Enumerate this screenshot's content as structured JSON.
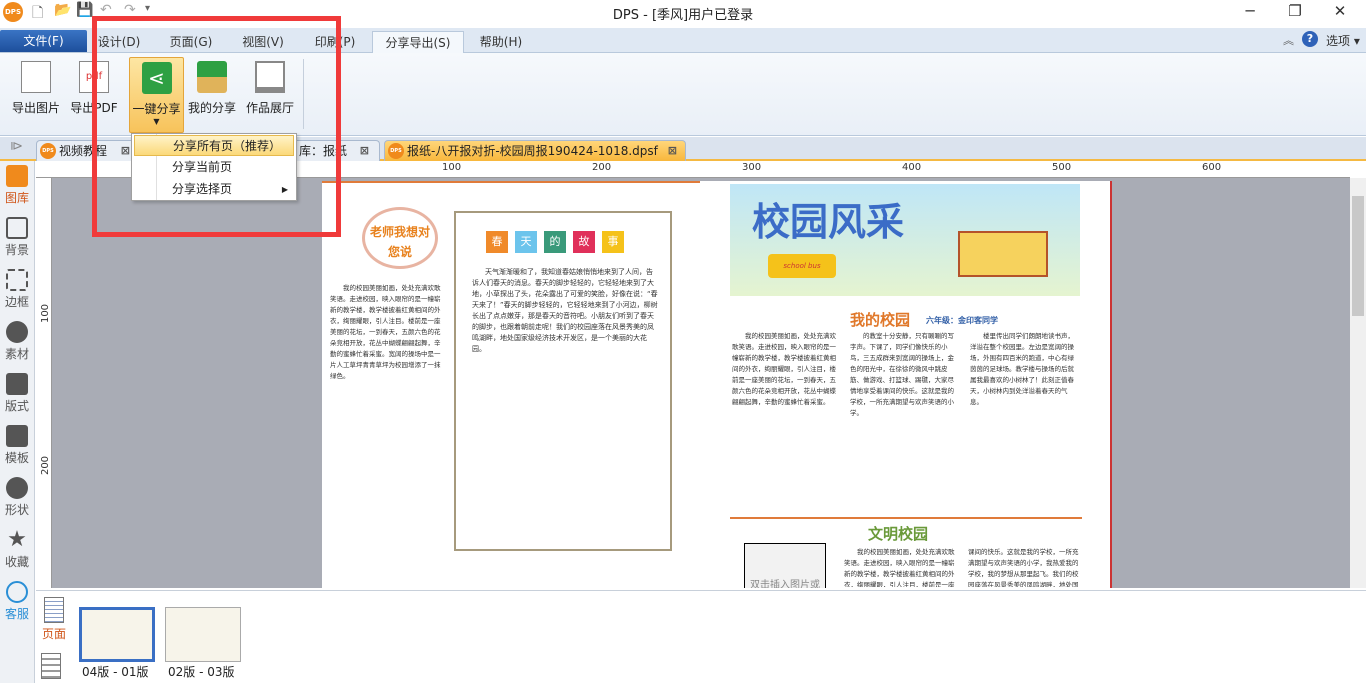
{
  "app": {
    "title": "DPS - [季风]用户已登录",
    "logo": "DPS"
  },
  "menu": {
    "tabs": [
      "文件(F)",
      "设计(D)",
      "页面(G)",
      "视图(V)",
      "印刷(P)",
      "分享导出(S)",
      "帮助(H)"
    ],
    "options": "选项"
  },
  "ribbon": {
    "buttons": [
      "导出图片",
      "导出PDF",
      "一键分享",
      "我的分享",
      "作品展厅"
    ]
  },
  "dropdown": {
    "items": [
      "分享所有页（推荐）",
      "分享当前页",
      "分享选择页"
    ]
  },
  "doc_tabs": [
    {
      "label": "视频教程"
    },
    {
      "label": "库：报纸"
    },
    {
      "label": "报纸-八开报对折-校园周报190424-1018.dpsf"
    }
  ],
  "sidebar": [
    "图库",
    "背景",
    "边框",
    "素材",
    "版式",
    "模板",
    "形状",
    "收藏",
    "客服"
  ],
  "ruler": {
    "top": [
      "100",
      "200",
      "300",
      "400",
      "500",
      "600"
    ],
    "left": [
      "100",
      "200"
    ]
  },
  "newspaper": {
    "left_title": "老师我想对您说",
    "story_title": [
      "春",
      "天",
      "的",
      "故",
      "事"
    ],
    "left_col": "我的校园美丽如画，处处充满欢歌笑语。走进校园，映入眼帘的是一幢崭新的教学楼，教学楼披着红黄相间的外衣，绚丽耀眼，引人注目。楼前是一座美丽的花坛，一到春天，五颜六色的花朵竞相开放，花丛中蝴蝶翩翩起舞，辛勤的蜜蜂忙着采蜜。宽阔的操场中是一片人工草坪青青草坪为校园增添了一抹绿色。",
    "story_text": "天气渐渐暖和了，我知道春姑娘悄悄地来到了人间，告诉人们春天的消息。春天的脚步轻轻的，它轻轻地来到了大地，小草探出了头，花朵露出了可爱的笑脸，好像在说：“春天来了！”春天的脚步轻轻的，它轻轻地来到了小河边，柳树长出了点点嫩芽，那是春天的音符吧。小朋友们听到了春天的脚步，也跟着朝前走呢！我们的校园座落在风景秀美的凤鸣湖畔，地处国家级经济技术开发区，是一个美丽的大花园。",
    "right_banner": "校园风采",
    "bus": "school bus",
    "my_school": "我的校园",
    "grade": "六年级：金印客同学",
    "rc1": "我的校园美丽如画，处处充满欢歌笑语。走进校园，映入眼帘的是一幢崭新的教学楼，教学楼披着红黄相间的外衣，绚丽耀眼，引人注目，楼前是一座美丽的花坛，一到春天，五颜六色的花朵竞相开放，花丛中蝴蝶翩翩起舞，辛勤的蜜蜂忙着采蜜。",
    "rc2": "的教室十分安静，只有唰唰的写字声。下课了，同学们像快乐的小鸟，三五成群来到宽阔的操场上，金色的阳光中，在徐徐的微风中跳皮筋、做游戏、打篮球、踢毽，大家尽情地享受着课间的快乐。这就是我的学校，一所充满期望与欢声笑语的小学。",
    "rc3": "楼里传出同学们朗朗地读书声，洋溢在整个校园里。左边是宽阔的操场，外围有四百米的跑道，中心有绿茵茵的足球场。教学楼与操场的后就属我最喜欢的小树林了！此刻正值春天，小树林内到处洋溢着春天的气息。",
    "civil": "文明校园",
    "placeholder": "双击插入图片或",
    "cc1": "我的校园美丽如画，处处充满欢歌笑语。走进校园，映入眼帘的是一幢崭新的教学楼，教学楼披着红黄相间的外衣，绚丽耀眼，引人注目，楼前是一座",
    "cc2": "课间的快乐。这就是我的学校，一所充满期望与欢声笑语的小学，我热爱我的学校，我的梦想从那里起飞。我们的校园座落在风景秀美的凤鸣湖畔，地处国"
  },
  "pages_panel": {
    "tab": "页面",
    "thumbs": [
      "04版 - 01版",
      "02版 - 03版"
    ]
  },
  "colors": {
    "accent": "#f5b942",
    "highlight": "#f03a3a"
  }
}
